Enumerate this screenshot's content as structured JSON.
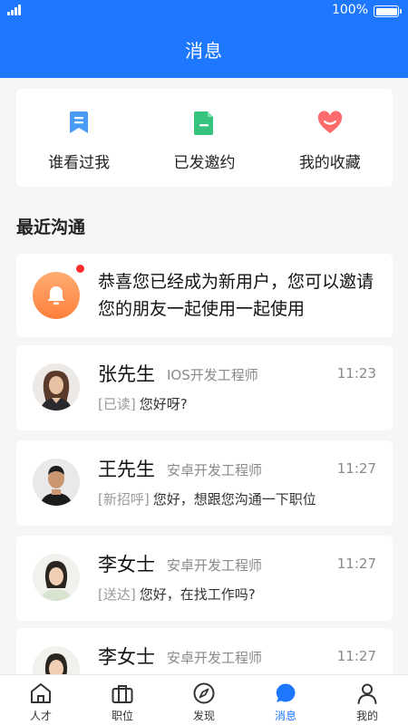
{
  "status_bar": {
    "battery_text": "100%"
  },
  "header": {
    "title": "消息"
  },
  "shortcuts": [
    {
      "label": "谁看过我",
      "icon": "bookmark-icon",
      "color": "#4a9bf5"
    },
    {
      "label": "已发邀约",
      "icon": "document-icon",
      "color": "#36c37e"
    },
    {
      "label": "我的收藏",
      "icon": "heart-icon",
      "color": "#ff6b6b"
    }
  ],
  "section_title": "最近沟通",
  "notice": {
    "text": "恭喜您已经成为新用户，您可以邀请您的朋友一起使用一起使用",
    "icon": "bell-icon",
    "unread": true
  },
  "chats": [
    {
      "name": "张先生",
      "role": "IOS开发工程师",
      "time": "11:23",
      "tag": "[已读]",
      "message": "您好呀?"
    },
    {
      "name": "王先生",
      "role": "安卓开发工程师",
      "time": "11:27",
      "tag": "[新招呼]",
      "message": "您好，想跟您沟通一下职位"
    },
    {
      "name": "李女士",
      "role": "安卓开发工程师",
      "time": "11:27",
      "tag": "[送达]",
      "message": "您好，在找工作吗?"
    },
    {
      "name": "李女士",
      "role": "安卓开发工程师",
      "time": "11:27",
      "tag": "",
      "message": ""
    }
  ],
  "tabs": [
    {
      "label": "人才",
      "icon": "home-icon",
      "active": false
    },
    {
      "label": "职位",
      "icon": "briefcase-icon",
      "active": false
    },
    {
      "label": "发现",
      "icon": "compass-icon",
      "active": false
    },
    {
      "label": "消息",
      "icon": "chat-bubble-icon",
      "active": true
    },
    {
      "label": "我的",
      "icon": "user-icon",
      "active": false
    }
  ],
  "colors": {
    "primary": "#1e78ff",
    "background": "#f5f6f7"
  }
}
